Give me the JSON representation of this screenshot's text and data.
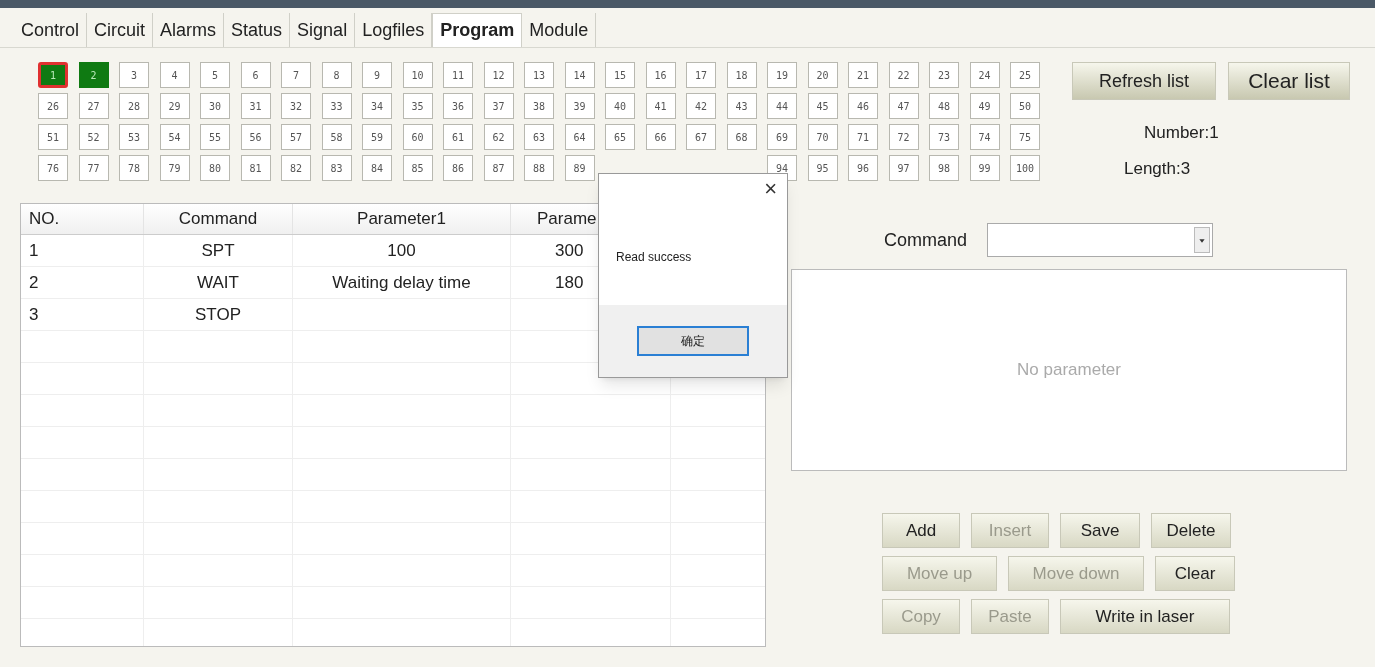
{
  "tabs": [
    {
      "label": "Control",
      "selected": false
    },
    {
      "label": "Circuit",
      "selected": false
    },
    {
      "label": "Alarms",
      "selected": false
    },
    {
      "label": "Status",
      "selected": false
    },
    {
      "label": "Signal",
      "selected": false
    },
    {
      "label": "Logfiles",
      "selected": false
    },
    {
      "label": "Program",
      "selected": true
    },
    {
      "label": "Module",
      "selected": false
    }
  ],
  "slots": [
    {
      "kind": "slot",
      "label": "1",
      "filled": true,
      "selected": true
    },
    {
      "kind": "slot",
      "label": "2",
      "filled": true,
      "selected": false
    },
    {
      "kind": "slot",
      "label": "3",
      "filled": false,
      "selected": false
    },
    {
      "kind": "slot",
      "label": "4",
      "filled": false,
      "selected": false
    },
    {
      "kind": "slot",
      "label": "5",
      "filled": false,
      "selected": false
    },
    {
      "kind": "slot",
      "label": "6",
      "filled": false,
      "selected": false
    },
    {
      "kind": "slot",
      "label": "7",
      "filled": false,
      "selected": false
    },
    {
      "kind": "slot",
      "label": "8",
      "filled": false,
      "selected": false
    },
    {
      "kind": "slot",
      "label": "9",
      "filled": false,
      "selected": false
    },
    {
      "kind": "slot",
      "label": "10",
      "filled": false,
      "selected": false
    },
    {
      "kind": "slot",
      "label": "11",
      "filled": false,
      "selected": false
    },
    {
      "kind": "slot",
      "label": "12",
      "filled": false,
      "selected": false
    },
    {
      "kind": "slot",
      "label": "13",
      "filled": false,
      "selected": false
    },
    {
      "kind": "slot",
      "label": "14",
      "filled": false,
      "selected": false
    },
    {
      "kind": "slot",
      "label": "15",
      "filled": false,
      "selected": false
    },
    {
      "kind": "slot",
      "label": "16",
      "filled": false,
      "selected": false
    },
    {
      "kind": "slot",
      "label": "17",
      "filled": false,
      "selected": false
    },
    {
      "kind": "slot",
      "label": "18",
      "filled": false,
      "selected": false
    },
    {
      "kind": "slot",
      "label": "19",
      "filled": false,
      "selected": false
    },
    {
      "kind": "slot",
      "label": "20",
      "filled": false,
      "selected": false
    },
    {
      "kind": "slot",
      "label": "21",
      "filled": false,
      "selected": false
    },
    {
      "kind": "slot",
      "label": "22",
      "filled": false,
      "selected": false
    },
    {
      "kind": "slot",
      "label": "23",
      "filled": false,
      "selected": false
    },
    {
      "kind": "slot",
      "label": "24",
      "filled": false,
      "selected": false
    },
    {
      "kind": "slot",
      "label": "25",
      "filled": false,
      "selected": false
    },
    {
      "kind": "slot",
      "label": "26",
      "filled": false,
      "selected": false
    },
    {
      "kind": "slot",
      "label": "27",
      "filled": false,
      "selected": false
    },
    {
      "kind": "slot",
      "label": "28",
      "filled": false,
      "selected": false
    },
    {
      "kind": "slot",
      "label": "29",
      "filled": false,
      "selected": false
    },
    {
      "kind": "slot",
      "label": "30",
      "filled": false,
      "selected": false
    },
    {
      "kind": "slot",
      "label": "31",
      "filled": false,
      "selected": false
    },
    {
      "kind": "slot",
      "label": "32",
      "filled": false,
      "selected": false
    },
    {
      "kind": "slot",
      "label": "33",
      "filled": false,
      "selected": false
    },
    {
      "kind": "slot",
      "label": "34",
      "filled": false,
      "selected": false
    },
    {
      "kind": "slot",
      "label": "35",
      "filled": false,
      "selected": false
    },
    {
      "kind": "slot",
      "label": "36",
      "filled": false,
      "selected": false
    },
    {
      "kind": "slot",
      "label": "37",
      "filled": false,
      "selected": false
    },
    {
      "kind": "slot",
      "label": "38",
      "filled": false,
      "selected": false
    },
    {
      "kind": "slot",
      "label": "39",
      "filled": false,
      "selected": false
    },
    {
      "kind": "slot",
      "label": "40",
      "filled": false,
      "selected": false
    },
    {
      "kind": "slot",
      "label": "41",
      "filled": false,
      "selected": false
    },
    {
      "kind": "slot",
      "label": "42",
      "filled": false,
      "selected": false
    },
    {
      "kind": "slot",
      "label": "43",
      "filled": false,
      "selected": false
    },
    {
      "kind": "slot",
      "label": "44",
      "filled": false,
      "selected": false
    },
    {
      "kind": "slot",
      "label": "45",
      "filled": false,
      "selected": false
    },
    {
      "kind": "slot",
      "label": "46",
      "filled": false,
      "selected": false
    },
    {
      "kind": "slot",
      "label": "47",
      "filled": false,
      "selected": false
    },
    {
      "kind": "slot",
      "label": "48",
      "filled": false,
      "selected": false
    },
    {
      "kind": "slot",
      "label": "49",
      "filled": false,
      "selected": false
    },
    {
      "kind": "slot",
      "label": "50",
      "filled": false,
      "selected": false
    },
    {
      "kind": "slot",
      "label": "51",
      "filled": false,
      "selected": false
    },
    {
      "kind": "slot",
      "label": "52",
      "filled": false,
      "selected": false
    },
    {
      "kind": "slot",
      "label": "53",
      "filled": false,
      "selected": false
    },
    {
      "kind": "slot",
      "label": "54",
      "filled": false,
      "selected": false
    },
    {
      "kind": "slot",
      "label": "55",
      "filled": false,
      "selected": false
    },
    {
      "kind": "slot",
      "label": "56",
      "filled": false,
      "selected": false
    },
    {
      "kind": "slot",
      "label": "57",
      "filled": false,
      "selected": false
    },
    {
      "kind": "slot",
      "label": "58",
      "filled": false,
      "selected": false
    },
    {
      "kind": "slot",
      "label": "59",
      "filled": false,
      "selected": false
    },
    {
      "kind": "slot",
      "label": "60",
      "filled": false,
      "selected": false
    },
    {
      "kind": "slot",
      "label": "61",
      "filled": false,
      "selected": false
    },
    {
      "kind": "slot",
      "label": "62",
      "filled": false,
      "selected": false
    },
    {
      "kind": "slot",
      "label": "63",
      "filled": false,
      "selected": false
    },
    {
      "kind": "slot",
      "label": "64",
      "filled": false,
      "selected": false
    },
    {
      "kind": "slot",
      "label": "65",
      "filled": false,
      "selected": false
    },
    {
      "kind": "slot",
      "label": "66",
      "filled": false,
      "selected": false
    },
    {
      "kind": "slot",
      "label": "67",
      "filled": false,
      "selected": false
    },
    {
      "kind": "slot",
      "label": "68",
      "filled": false,
      "selected": false
    },
    {
      "kind": "slot",
      "label": "69",
      "filled": false,
      "selected": false
    },
    {
      "kind": "slot",
      "label": "70",
      "filled": false,
      "selected": false
    },
    {
      "kind": "slot",
      "label": "71",
      "filled": false,
      "selected": false
    },
    {
      "kind": "slot",
      "label": "72",
      "filled": false,
      "selected": false
    },
    {
      "kind": "slot",
      "label": "73",
      "filled": false,
      "selected": false
    },
    {
      "kind": "slot",
      "label": "74",
      "filled": false,
      "selected": false
    },
    {
      "kind": "slot",
      "label": "75",
      "filled": false,
      "selected": false
    },
    {
      "kind": "slot",
      "label": "76",
      "filled": false,
      "selected": false
    },
    {
      "kind": "slot",
      "label": "77",
      "filled": false,
      "selected": false
    },
    {
      "kind": "slot",
      "label": "78",
      "filled": false,
      "selected": false
    },
    {
      "kind": "slot",
      "label": "79",
      "filled": false,
      "selected": false
    },
    {
      "kind": "slot",
      "label": "80",
      "filled": false,
      "selected": false
    },
    {
      "kind": "slot",
      "label": "81",
      "filled": false,
      "selected": false
    },
    {
      "kind": "slot",
      "label": "82",
      "filled": false,
      "selected": false
    },
    {
      "kind": "slot",
      "label": "83",
      "filled": false,
      "selected": false
    },
    {
      "kind": "slot",
      "label": "84",
      "filled": false,
      "selected": false
    },
    {
      "kind": "slot",
      "label": "85",
      "filled": false,
      "selected": false
    },
    {
      "kind": "slot",
      "label": "86",
      "filled": false,
      "selected": false
    },
    {
      "kind": "slot",
      "label": "87",
      "filled": false,
      "selected": false
    },
    {
      "kind": "slot",
      "label": "88",
      "filled": false,
      "selected": false
    },
    {
      "kind": "slot",
      "label": "89",
      "filled": false,
      "selected": false
    },
    {
      "kind": "covered"
    },
    {
      "kind": "covered"
    },
    {
      "kind": "covered"
    },
    {
      "kind": "covered"
    },
    {
      "kind": "slot",
      "label": "94",
      "filled": false,
      "selected": false
    },
    {
      "kind": "slot",
      "label": "95",
      "filled": false,
      "selected": false
    },
    {
      "kind": "slot",
      "label": "96",
      "filled": false,
      "selected": false
    },
    {
      "kind": "slot",
      "label": "97",
      "filled": false,
      "selected": false
    },
    {
      "kind": "slot",
      "label": "98",
      "filled": false,
      "selected": false
    },
    {
      "kind": "slot",
      "label": "99",
      "filled": false,
      "selected": false
    },
    {
      "kind": "slot",
      "label": "100",
      "filled": false,
      "selected": false
    }
  ],
  "list_buttons": [
    {
      "label": "Refresh list"
    },
    {
      "label": "Clear list"
    }
  ],
  "number": "Number:1",
  "length": "Length:3",
  "table": {
    "columns": [
      "NO.",
      "Command",
      "Parameter1",
      "Parame"
    ],
    "rows": [
      [
        "1",
        "SPT",
        "100",
        "300"
      ],
      [
        "2",
        "WAIT",
        "Waiting delay time",
        "180"
      ],
      [
        "3",
        "STOP",
        "",
        ""
      ]
    ]
  },
  "command": {
    "label": "Command"
  },
  "parameter_panel": {
    "text": "No parameter"
  },
  "actions": [
    [
      {
        "label": "Add",
        "disabled": false
      },
      {
        "label": "Insert",
        "disabled": true
      },
      {
        "label": "Save",
        "disabled": false
      },
      {
        "label": "Delete",
        "disabled": false
      }
    ],
    [
      {
        "label": "Move up",
        "disabled": true
      },
      {
        "label": "Move down",
        "disabled": true
      },
      {
        "label": "Clear",
        "disabled": false
      }
    ],
    [
      {
        "label": "Copy",
        "disabled": true
      },
      {
        "label": "Paste",
        "disabled": true
      },
      {
        "label": "Write in laser",
        "disabled": false
      }
    ]
  ],
  "dialog": {
    "message": "Read success",
    "close": "×",
    "button": "确定"
  }
}
